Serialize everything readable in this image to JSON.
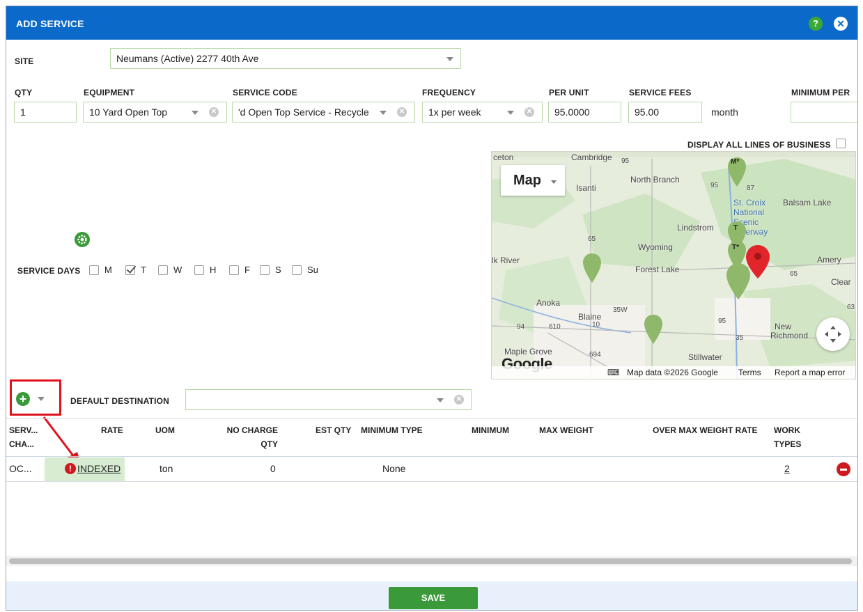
{
  "dialog": {
    "title": "ADD SERVICE",
    "help_label": "?",
    "close_label": "✕"
  },
  "site": {
    "label": "SITE",
    "value": "Neumans (Active) 2277 40th Ave"
  },
  "fields": {
    "qty": {
      "label": "QTY",
      "value": "1"
    },
    "equipment": {
      "label": "EQUIPMENT",
      "value": "10 Yard Open Top"
    },
    "service_code": {
      "label": "SERVICE CODE",
      "value": "'d Open Top Service - Recycle"
    },
    "frequency": {
      "label": "FREQUENCY",
      "value": "1x per week"
    },
    "per_unit": {
      "label": "PER UNIT",
      "value": "95.0000"
    },
    "service_fees": {
      "label": "SERVICE FEES",
      "value": "95.00",
      "suffix": "month"
    },
    "minimum_per": {
      "label": "MINIMUM PER",
      "value": ""
    }
  },
  "display_all": {
    "label": "DISPLAY ALL LINES OF BUSINESS",
    "checked": false
  },
  "service_days": {
    "label": "SERVICE DAYS",
    "days": [
      {
        "label": "M",
        "checked": false
      },
      {
        "label": "T",
        "checked": true
      },
      {
        "label": "W",
        "checked": false
      },
      {
        "label": "H",
        "checked": false
      },
      {
        "label": "F",
        "checked": false
      },
      {
        "label": "S",
        "checked": false
      },
      {
        "label": "Su",
        "checked": false
      }
    ]
  },
  "map": {
    "type_label": "Map",
    "places": [
      "ceton",
      "Cambridge",
      "95",
      "Isanti",
      "North Branch",
      "95",
      "87",
      "St. Croix",
      "National",
      "Scenic",
      "Riverway",
      "Balsam Lake",
      "Lindstrom",
      "65",
      "Wyoming",
      "lk River",
      "Forest Lake",
      "Amery",
      "65",
      "Clear",
      "Anoka",
      "Blaine",
      "35W",
      "10",
      "94",
      "610",
      "95",
      "New",
      "Richmond",
      "35",
      "Maple Grove",
      "694",
      "Stillwater",
      "63"
    ],
    "markers": [
      "M*",
      "T",
      "T*"
    ],
    "logo": "Google",
    "attribution": {
      "data": "Map data ©2026 Google",
      "terms": "Terms",
      "report": "Report a map error"
    }
  },
  "destination": {
    "label": "DEFAULT DESTINATION",
    "value": ""
  },
  "table": {
    "headers": {
      "service_charge": [
        "SERV...",
        "CHA..."
      ],
      "rate": "RATE",
      "uom": "UOM",
      "no_charge_qty": [
        "NO CHARGE",
        "QTY"
      ],
      "est_qty": "EST QTY",
      "minimum_type": "MINIMUM TYPE",
      "minimum": "MINIMUM",
      "max_weight": "MAX WEIGHT",
      "over_max_weight_rate": "OVER MAX WEIGHT RATE",
      "work_types": [
        "WORK",
        "TYPES"
      ]
    },
    "rows": [
      {
        "service_charge": "OC...",
        "rate": "INDEXED",
        "uom": "ton",
        "no_charge_qty": "0",
        "minimum_type": "None",
        "work_types": "2"
      }
    ]
  },
  "save_label": "SAVE",
  "colors": {
    "header_blue": "#0b6ac9",
    "accent_green": "#3a9a3a",
    "annotation_red": "#e0121b"
  }
}
